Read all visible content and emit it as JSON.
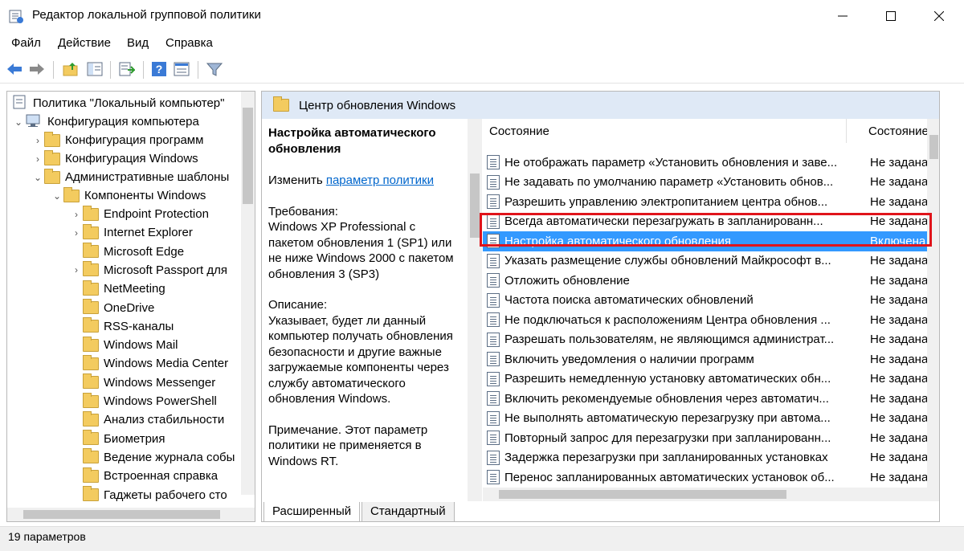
{
  "window": {
    "title": "Редактор локальной групповой политики",
    "minimize_glyph": "—",
    "maximize_glyph": "☐",
    "close_glyph": "✕"
  },
  "menu": {
    "file": "Файл",
    "action": "Действие",
    "view": "Вид",
    "help": "Справка"
  },
  "toolbar": {
    "icons": [
      "back-arrow-icon",
      "forward-arrow-icon",
      "up-folder-icon",
      "show-hide-tree-icon",
      "export-list-icon",
      "help-icon",
      "properties-icon",
      "filter-icon"
    ]
  },
  "tree": {
    "root": "Политика \"Локальный компьютер\"",
    "computer_config": "Конфигурация компьютера",
    "software_config": "Конфигурация программ",
    "windows_config": "Конфигурация Windows",
    "admin_templates": "Административные шаблоны",
    "windows_components": "Компоненты Windows",
    "children": [
      {
        "label": "Endpoint Protection",
        "expandable": true
      },
      {
        "label": "Internet Explorer",
        "expandable": true
      },
      {
        "label": "Microsoft Edge",
        "expandable": false
      },
      {
        "label": "Microsoft Passport для",
        "expandable": true
      },
      {
        "label": "NetMeeting",
        "expandable": false
      },
      {
        "label": "OneDrive",
        "expandable": false
      },
      {
        "label": "RSS-каналы",
        "expandable": false
      },
      {
        "label": "Windows Mail",
        "expandable": false
      },
      {
        "label": "Windows Media Center",
        "expandable": false
      },
      {
        "label": "Windows Messenger",
        "expandable": false
      },
      {
        "label": "Windows PowerShell",
        "expandable": false
      },
      {
        "label": "Анализ стабильности",
        "expandable": false
      },
      {
        "label": "Биометрия",
        "expandable": false
      },
      {
        "label": "Ведение журнала собы",
        "expandable": false
      },
      {
        "label": "Встроенная справка",
        "expandable": false
      },
      {
        "label": "Гаджеты рабочего сто",
        "expandable": false
      }
    ]
  },
  "detail": {
    "folder_title": "Центр обновления Windows",
    "setting_title": "Настройка автоматического обновления",
    "edit_prefix": "Изменить ",
    "edit_link": "параметр политики",
    "requirements_label": "Требования:",
    "requirements_text": "Windows XP Professional с пакетом обновления 1 (SP1) или не ниже Windows 2000 с пакетом обновления 3 (SP3)",
    "description_label": "Описание:",
    "description_text": "Указывает, будет ли данный компьютер получать обновления безопасности и другие важные загружаемые компоненты через службу автоматического обновления Windows.",
    "note_text": "Примечание. Этот параметр политики не применяется в Windows RT."
  },
  "list": {
    "col_setting": "Состояние",
    "col_state": "Состояние",
    "rows": [
      {
        "name": "Не отображать параметр «Установить обновления и заве...",
        "state": "Не задана"
      },
      {
        "name": "Не задавать по умолчанию параметр «Установить обнов...",
        "state": "Не задана"
      },
      {
        "name": "Разрешить управлению электропитанием центра обнов...",
        "state": "Не задана"
      },
      {
        "name": "Всегда автоматически перезагружать в запланированн...",
        "state": "Не задана"
      },
      {
        "name": "Настройка автоматического обновления",
        "state": "Включена"
      },
      {
        "name": "Указать размещение службы обновлений Майкрософт в...",
        "state": "Не задана"
      },
      {
        "name": "Отложить обновление",
        "state": "Не задана"
      },
      {
        "name": "Частота поиска автоматических обновлений",
        "state": "Не задана"
      },
      {
        "name": "Не подключаться к расположениям Центра обновления ...",
        "state": "Не задана"
      },
      {
        "name": "Разрешать пользователям, не являющимся администрат...",
        "state": "Не задана"
      },
      {
        "name": "Включить уведомления о наличии программ",
        "state": "Не задана"
      },
      {
        "name": "Разрешить немедленную установку автоматических обн...",
        "state": "Не задана"
      },
      {
        "name": "Включить рекомендуемые обновления через автоматич...",
        "state": "Не задана"
      },
      {
        "name": "Не выполнять автоматическую перезагрузку при автома...",
        "state": "Не задана"
      },
      {
        "name": "Повторный запрос для перезагрузки при запланированн...",
        "state": "Не задана"
      },
      {
        "name": "Задержка перезагрузки при запланированных установках",
        "state": "Не задана"
      },
      {
        "name": "Перенос запланированных автоматических установок об...",
        "state": "Не задана"
      }
    ]
  },
  "tabs": {
    "extended": "Расширенный",
    "standard": "Стандартный"
  },
  "status": {
    "text": "19 параметров"
  },
  "colors": {
    "selection": "#3399ff",
    "highlight_box": "#e0141b",
    "header_band": "#dfe9f6",
    "link": "#0066cc"
  }
}
